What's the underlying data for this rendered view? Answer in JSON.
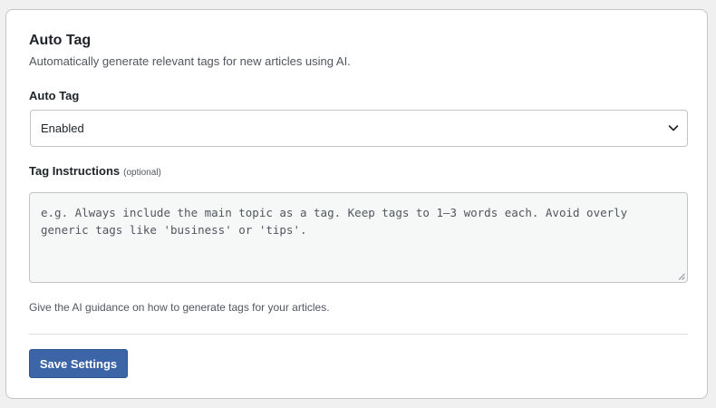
{
  "section": {
    "title": "Auto Tag",
    "description": "Automatically generate relevant tags for new articles using AI."
  },
  "auto_tag_field": {
    "label": "Auto Tag",
    "selected_value": "Enabled",
    "icon": "chevron-down-icon"
  },
  "instructions_field": {
    "label": "Tag Instructions",
    "optional_label": "(optional)",
    "placeholder": "e.g. Always include the main topic as a tag. Keep tags to 1–3 words each. Avoid overly generic tags like 'business' or 'tips'.",
    "help_text": "Give the AI guidance on how to generate tags for your articles."
  },
  "actions": {
    "save_label": "Save Settings"
  },
  "colors": {
    "primary_button": "#3b65a6",
    "card_border": "#c3c4c7",
    "textarea_background": "#f6f7f7"
  }
}
